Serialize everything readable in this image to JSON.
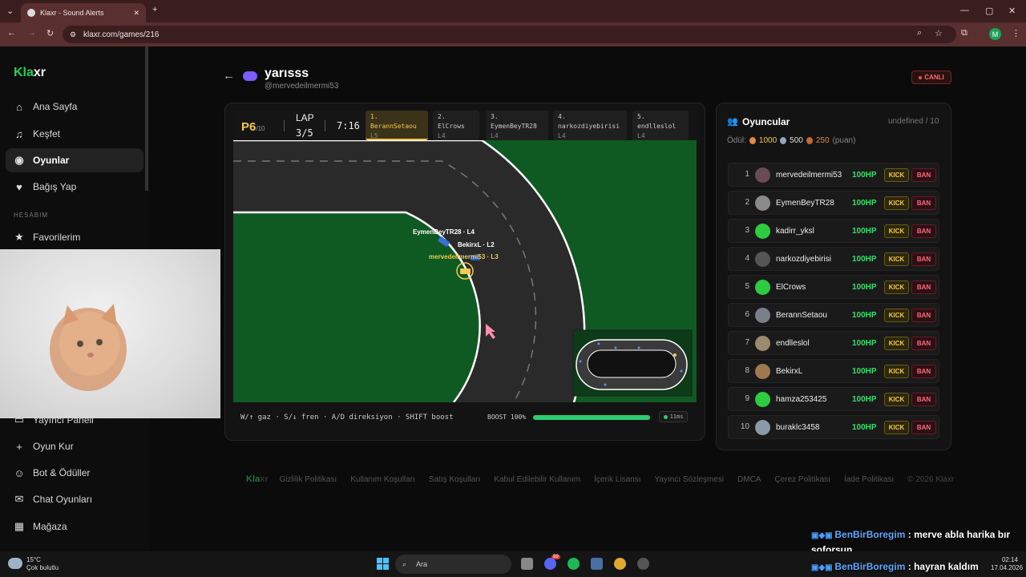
{
  "browser": {
    "tab_title": "Klaxr - Sound Alerts",
    "url": "klaxr.com/games/216",
    "profile_initial": "M"
  },
  "sidebar": {
    "logo_prefix": "Kla",
    "logo_suffix": "xr",
    "items": [
      {
        "label": "Ana Sayfa",
        "icon": "home-icon"
      },
      {
        "label": "Keşfet",
        "icon": "music-icon"
      },
      {
        "label": "Oyunlar",
        "icon": "gamepad-icon",
        "active": true
      },
      {
        "label": "Bağış Yap",
        "icon": "heart-icon"
      }
    ],
    "section_label": "HESABIM",
    "account_items": [
      {
        "label": "Favorilerim",
        "icon": "star-icon"
      },
      {
        "label": "Yayıncı Paneli",
        "icon": "monitor-icon"
      },
      {
        "label": "Oyun Kur",
        "icon": "plus-icon"
      },
      {
        "label": "Bot & Ödüller",
        "icon": "bot-icon"
      },
      {
        "label": "Chat Oyunları",
        "icon": "chat-icon"
      },
      {
        "label": "Mağaza",
        "icon": "store-icon"
      }
    ]
  },
  "header": {
    "title": "yarısss",
    "handle": "@mervedeilmermi53",
    "live_label": "CANLI"
  },
  "game": {
    "position": "P6",
    "position_total": "/10",
    "lap_label": "LAP",
    "lap_value": "3/5",
    "time": "7:16",
    "leaderboard": [
      {
        "rank": "1.",
        "name": "BerannSetaou",
        "lap": "L5"
      },
      {
        "rank": "2.",
        "name": "ElCrows",
        "lap": "L4"
      },
      {
        "rank": "3.",
        "name": "EymenBeyTR28",
        "lap": "L4"
      },
      {
        "rank": "4.",
        "name": "narkozdiyebirisi",
        "lap": "L4"
      },
      {
        "rank": "5.",
        "name": "endlleslol",
        "lap": "L4"
      }
    ],
    "car_labels": [
      {
        "text": "EymenBeyTR28 · L4"
      },
      {
        "text": "BekirxL · L2"
      },
      {
        "text": "mervedeilmermi53 · L3"
      }
    ],
    "controls": "W/↑ gaz · S/↓ fren · A/D direksiyon · SHIFT boost",
    "boost_label": "BOOST 100%",
    "boost_fraction": 1.0,
    "ping": "11ms",
    "colors": {
      "grass": "#0f5a23",
      "asphalt": "#2a2a2a",
      "leader": "#f2c94c"
    }
  },
  "players": {
    "title": "Oyuncular",
    "count": "undefined / 10",
    "prize_label": "Ödül:",
    "prizes": [
      "1000",
      "500",
      "250"
    ],
    "prize_unit": "(puan)",
    "kick_label": "KICK",
    "ban_label": "BAN",
    "list": [
      {
        "rank": "1",
        "name": "mervedeilmermi53",
        "hp": "100HP",
        "avatar": "#6b4a55"
      },
      {
        "rank": "2",
        "name": "EymenBeyTR28",
        "hp": "100HP",
        "avatar": "#8a8a8a"
      },
      {
        "rank": "3",
        "name": "kadirr_yksl",
        "hp": "100HP",
        "avatar": "#2ecc40"
      },
      {
        "rank": "4",
        "name": "narkozdiyebirisi",
        "hp": "100HP",
        "avatar": "#555555"
      },
      {
        "rank": "5",
        "name": "ElCrows",
        "hp": "100HP",
        "avatar": "#2ecc40"
      },
      {
        "rank": "6",
        "name": "BerannSetaou",
        "hp": "100HP",
        "avatar": "#7a7f88"
      },
      {
        "rank": "7",
        "name": "endlleslol",
        "hp": "100HP",
        "avatar": "#9a8a70"
      },
      {
        "rank": "8",
        "name": "BekirxL",
        "hp": "100HP",
        "avatar": "#a07850"
      },
      {
        "rank": "9",
        "name": "hamza253425",
        "hp": "100HP",
        "avatar": "#2ecc40"
      },
      {
        "rank": "10",
        "name": "buraklc3458",
        "hp": "100HP",
        "avatar": "#8a9aa8"
      }
    ]
  },
  "footer": {
    "logo_prefix": "Kla",
    "logo_suffix": "xr",
    "links": [
      "Gizlilik Politikası",
      "Kullanım Koşulları",
      "Satış Koşulları",
      "Kabul Edilebilir Kullanım",
      "İçerik Lisansı",
      "Yayıncı Sözleşmesi",
      "DMCA",
      "Çerez Politikası",
      "İade Politikası"
    ],
    "copyright": "© 2026 Klaxr"
  },
  "chat_overlay": [
    {
      "user": "BenBirBoregim",
      "message": ": merve abla harika bır",
      "message2": "soforsun"
    },
    {
      "user": "BenBirBoregim",
      "message": ": hayran kaldım"
    }
  ],
  "taskbar": {
    "temp": "15°C",
    "weather": "Çok bulutlu",
    "search": "Ara",
    "time": "02:14",
    "date": "17.04.2026",
    "discord_badge": "99"
  }
}
